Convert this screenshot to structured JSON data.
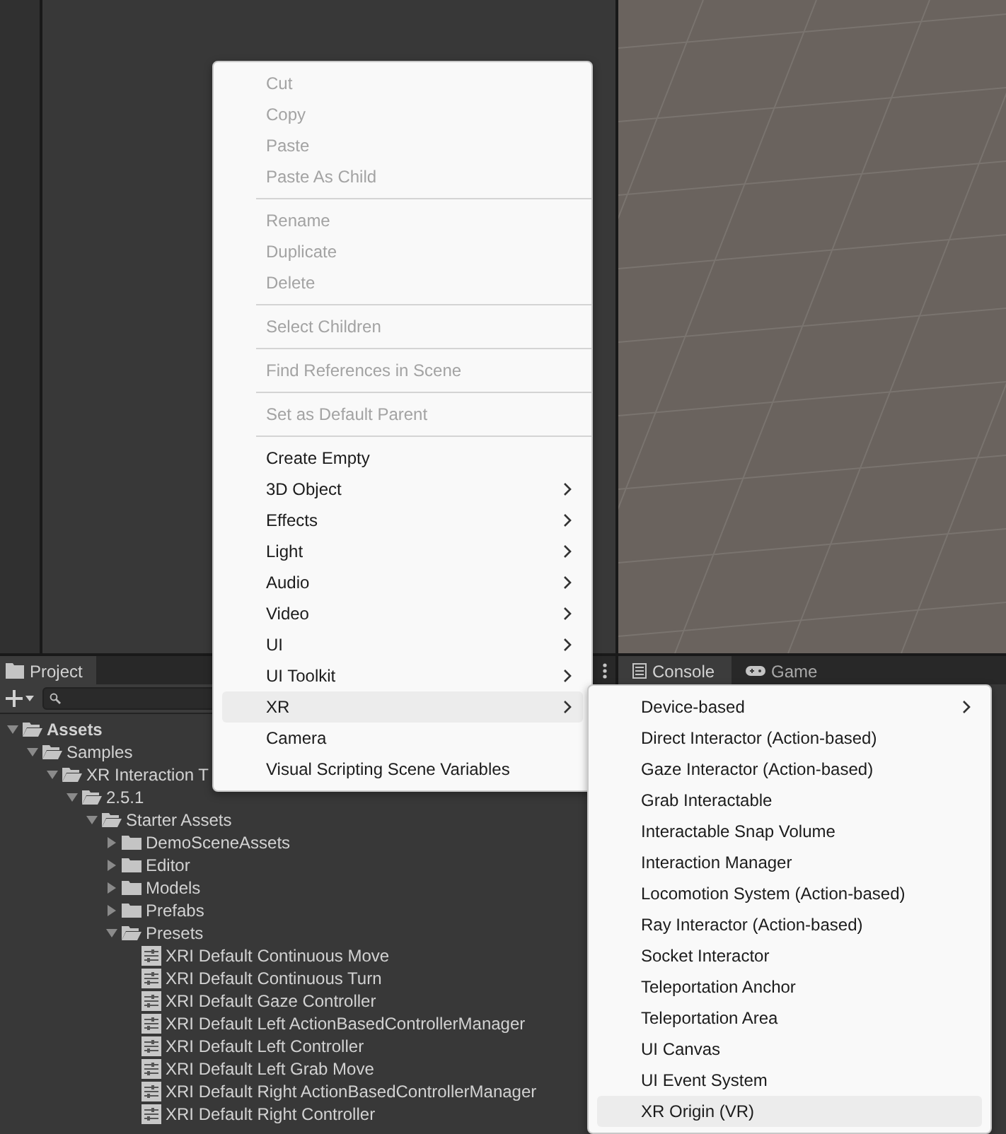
{
  "project_panel": {
    "tab": "Project",
    "tree": [
      {
        "name": "Assets",
        "kind": "folder",
        "expanded": true,
        "children": [
          {
            "name": "Samples",
            "kind": "folder",
            "expanded": true,
            "children": [
              {
                "name": "XR Interaction T",
                "kind": "folder",
                "expanded": true,
                "children": [
                  {
                    "name": "2.5.1",
                    "kind": "folder",
                    "expanded": true,
                    "children": [
                      {
                        "name": "Starter Assets",
                        "kind": "folder",
                        "expanded": true,
                        "children": [
                          {
                            "name": "DemoSceneAssets",
                            "kind": "folder",
                            "expanded": false
                          },
                          {
                            "name": "Editor",
                            "kind": "folder",
                            "expanded": false
                          },
                          {
                            "name": "Models",
                            "kind": "folder",
                            "expanded": false
                          },
                          {
                            "name": "Prefabs",
                            "kind": "folder",
                            "expanded": false
                          },
                          {
                            "name": "Presets",
                            "kind": "folder",
                            "expanded": true,
                            "children": [
                              {
                                "name": "XRI Default Continuous Move",
                                "kind": "preset"
                              },
                              {
                                "name": "XRI Default Continuous Turn",
                                "kind": "preset"
                              },
                              {
                                "name": "XRI Default Gaze Controller",
                                "kind": "preset"
                              },
                              {
                                "name": "XRI Default Left ActionBasedControllerManager",
                                "kind": "preset"
                              },
                              {
                                "name": "XRI Default Left Controller",
                                "kind": "preset"
                              },
                              {
                                "name": "XRI Default Left Grab Move",
                                "kind": "preset"
                              },
                              {
                                "name": "XRI Default Right ActionBasedControllerManager",
                                "kind": "preset"
                              },
                              {
                                "name": "XRI Default Right Controller",
                                "kind": "preset"
                              }
                            ]
                          }
                        ]
                      }
                    ]
                  }
                ]
              }
            ]
          }
        ]
      }
    ]
  },
  "console_panel": {
    "tabs": [
      {
        "label": "Console",
        "selected": true
      },
      {
        "label": "Game",
        "selected": false
      }
    ]
  },
  "context_menu": {
    "groups": [
      [
        {
          "label": "Cut",
          "disabled": true,
          "submenu": false,
          "selected": false
        },
        {
          "label": "Copy",
          "disabled": true,
          "submenu": false,
          "selected": false
        },
        {
          "label": "Paste",
          "disabled": true,
          "submenu": false,
          "selected": false
        },
        {
          "label": "Paste As Child",
          "disabled": true,
          "submenu": false,
          "selected": false
        }
      ],
      [
        {
          "label": "Rename",
          "disabled": true,
          "submenu": false,
          "selected": false
        },
        {
          "label": "Duplicate",
          "disabled": true,
          "submenu": false,
          "selected": false
        },
        {
          "label": "Delete",
          "disabled": true,
          "submenu": false,
          "selected": false
        }
      ],
      [
        {
          "label": "Select Children",
          "disabled": true,
          "submenu": false,
          "selected": false
        }
      ],
      [
        {
          "label": "Find References in Scene",
          "disabled": true,
          "submenu": false,
          "selected": false
        }
      ],
      [
        {
          "label": "Set as Default Parent",
          "disabled": true,
          "submenu": false,
          "selected": false
        }
      ],
      [
        {
          "label": "Create Empty",
          "disabled": false,
          "submenu": false,
          "selected": false
        },
        {
          "label": "3D Object",
          "disabled": false,
          "submenu": true,
          "selected": false
        },
        {
          "label": "Effects",
          "disabled": false,
          "submenu": true,
          "selected": false
        },
        {
          "label": "Light",
          "disabled": false,
          "submenu": true,
          "selected": false
        },
        {
          "label": "Audio",
          "disabled": false,
          "submenu": true,
          "selected": false
        },
        {
          "label": "Video",
          "disabled": false,
          "submenu": true,
          "selected": false
        },
        {
          "label": "UI",
          "disabled": false,
          "submenu": true,
          "selected": false
        },
        {
          "label": "UI Toolkit",
          "disabled": false,
          "submenu": true,
          "selected": false
        },
        {
          "label": "XR",
          "disabled": false,
          "submenu": true,
          "selected": true
        },
        {
          "label": "Camera",
          "disabled": false,
          "submenu": false,
          "selected": false
        },
        {
          "label": "Visual Scripting Scene Variables",
          "disabled": false,
          "submenu": false,
          "selected": false
        }
      ]
    ]
  },
  "xr_submenu": {
    "groups": [
      [
        {
          "label": "Device-based",
          "disabled": false,
          "submenu": true,
          "selected": false
        },
        {
          "label": "Direct Interactor (Action-based)",
          "disabled": false,
          "submenu": false,
          "selected": false
        },
        {
          "label": "Gaze Interactor (Action-based)",
          "disabled": false,
          "submenu": false,
          "selected": false
        },
        {
          "label": "Grab Interactable",
          "disabled": false,
          "submenu": false,
          "selected": false
        },
        {
          "label": "Interactable Snap Volume",
          "disabled": false,
          "submenu": false,
          "selected": false
        },
        {
          "label": "Interaction Manager",
          "disabled": false,
          "submenu": false,
          "selected": false
        },
        {
          "label": "Locomotion System (Action-based)",
          "disabled": false,
          "submenu": false,
          "selected": false
        },
        {
          "label": "Ray Interactor (Action-based)",
          "disabled": false,
          "submenu": false,
          "selected": false
        },
        {
          "label": "Socket Interactor",
          "disabled": false,
          "submenu": false,
          "selected": false
        },
        {
          "label": "Teleportation Anchor",
          "disabled": false,
          "submenu": false,
          "selected": false
        },
        {
          "label": "Teleportation Area",
          "disabled": false,
          "submenu": false,
          "selected": false
        },
        {
          "label": "UI Canvas",
          "disabled": false,
          "submenu": false,
          "selected": false
        },
        {
          "label": "UI Event System",
          "disabled": false,
          "submenu": false,
          "selected": false
        },
        {
          "label": "XR Origin (VR)",
          "disabled": false,
          "submenu": false,
          "selected": true
        }
      ]
    ]
  }
}
